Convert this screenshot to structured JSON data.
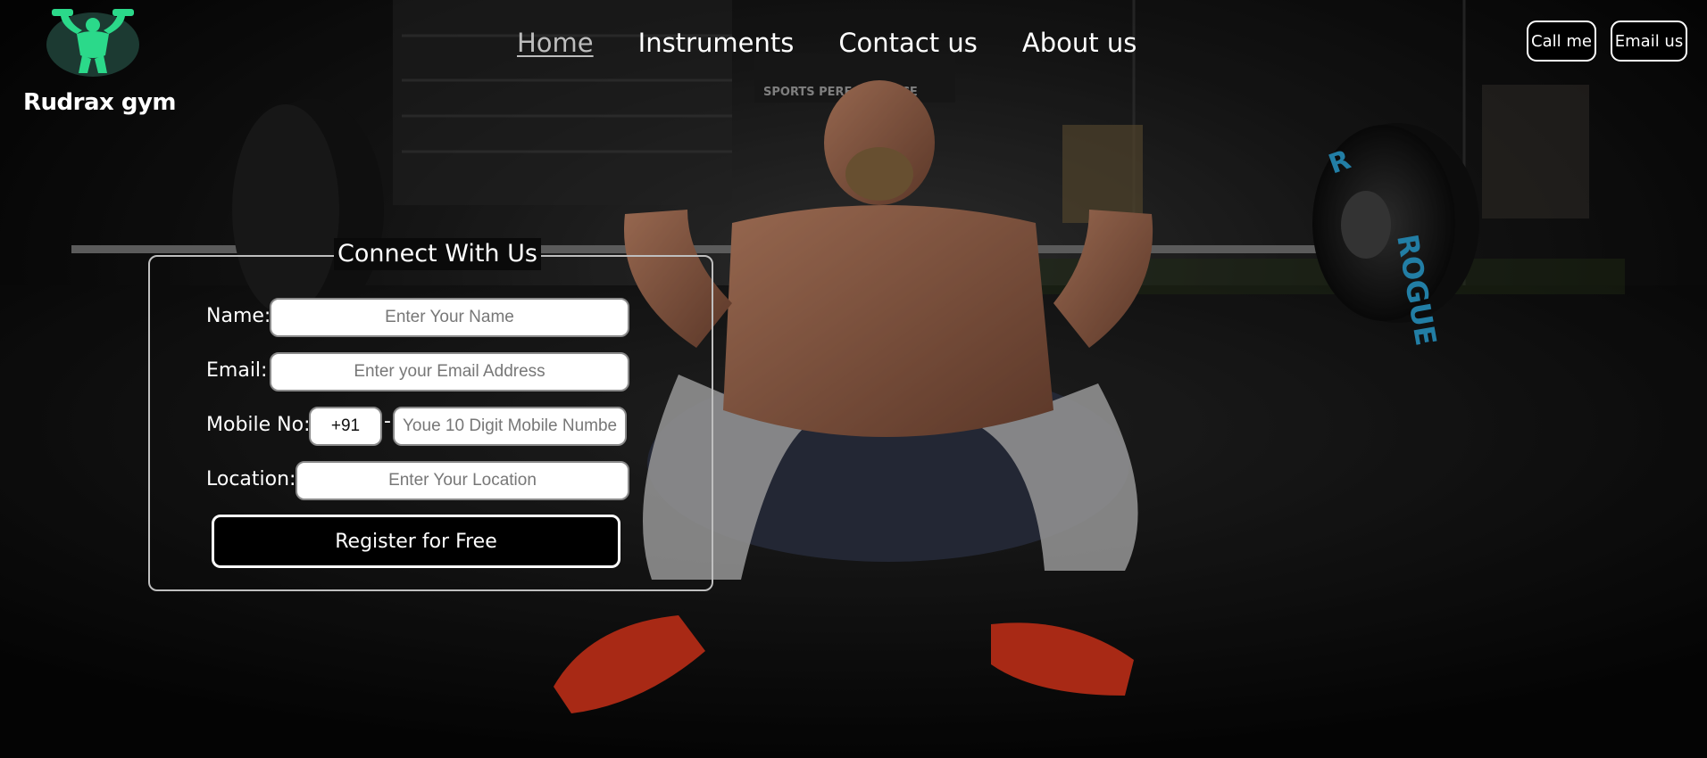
{
  "brand": {
    "name": "Rudrax gym",
    "logo_icon": "bodybuilder-logo-icon",
    "logo_color": "#2bd98a"
  },
  "nav": {
    "items": [
      {
        "label": "Home",
        "active": true
      },
      {
        "label": "Instruments",
        "active": false
      },
      {
        "label": "Contact us",
        "active": false
      },
      {
        "label": "About us",
        "active": false
      }
    ]
  },
  "header_buttons": {
    "call": "Call me",
    "email": "Email us"
  },
  "form": {
    "legend": "Connect With Us",
    "name_label": "Name:",
    "name_placeholder": "Enter Your Name",
    "email_label": "Email:",
    "email_placeholder": "Enter your Email Address",
    "mobile_label": "Mobile No:",
    "country_code": "+91",
    "separator": "-",
    "mobile_placeholder": "Youe 10 Digit Mobile Numbe",
    "location_label": "Location:",
    "location_placeholder": "Enter Your Location",
    "submit_label": "Register for Free"
  },
  "background": {
    "banner_text": "SPORTS PERFORMANCE",
    "plate_brand": "ROGUE",
    "plate_letter": "R",
    "plate_accent": "#2ea8dc",
    "shoe_color": "#e0371c"
  }
}
